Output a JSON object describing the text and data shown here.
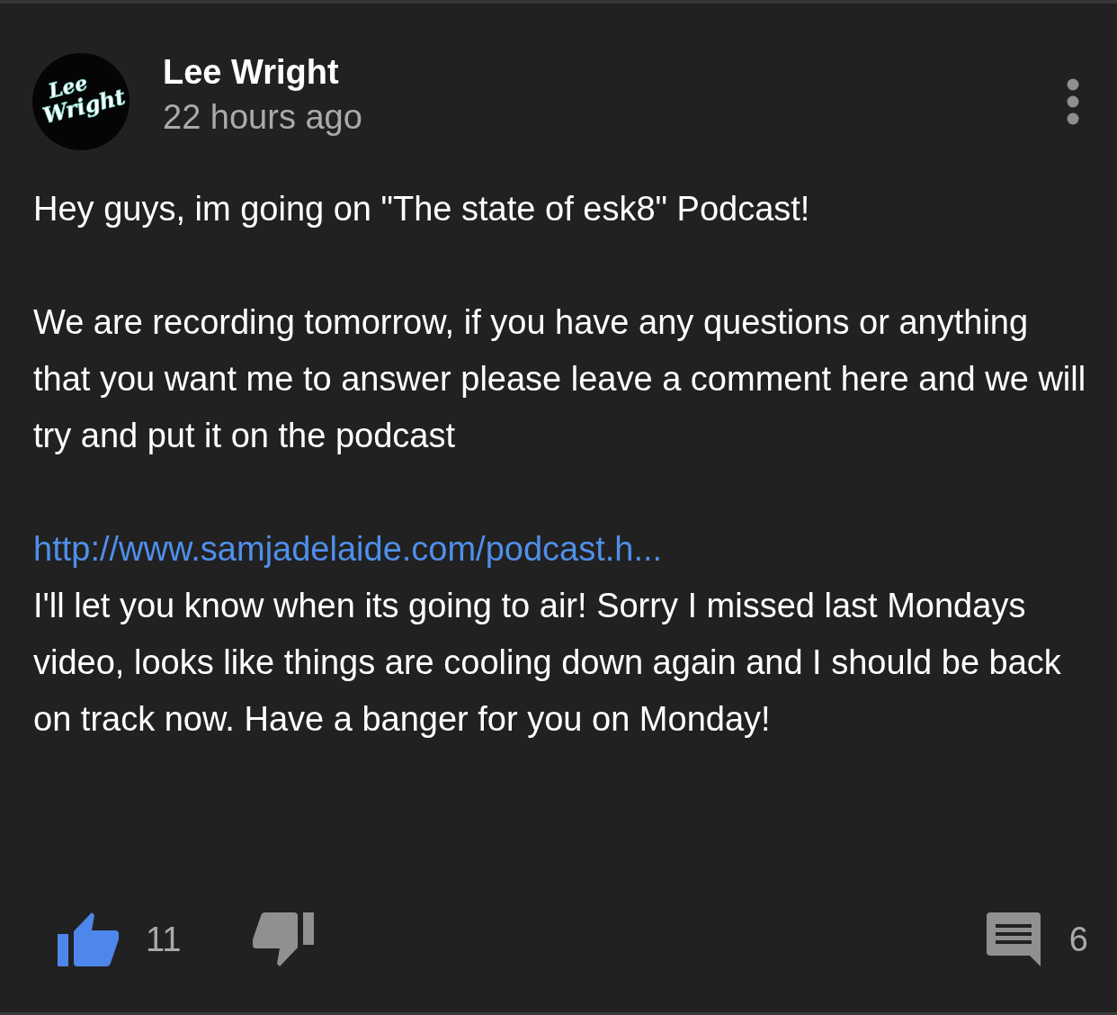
{
  "author": {
    "name": "Lee Wright",
    "logo_lines": [
      "Lee",
      "Wright"
    ]
  },
  "time": "22 hours ago",
  "body": {
    "paragraphs": [
      "Hey guys, im going on \"The state of esk8\" Podcast!",
      "We are recording tomorrow, if you have any questions or anything that you want me to answer please leave a comment here and we will try and put it on the podcast"
    ],
    "link": "http://www.samjadelaide.com/podcast.h...",
    "after_link": "I'll let you know when its going to air! Sorry I missed last Mondays video, looks like things are cooling down again and I should be back on track now. Have a banger for you on Monday!"
  },
  "like": {
    "selected": true,
    "count": "11"
  },
  "dislike": {
    "selected": false
  },
  "replies": {
    "count": "6"
  }
}
